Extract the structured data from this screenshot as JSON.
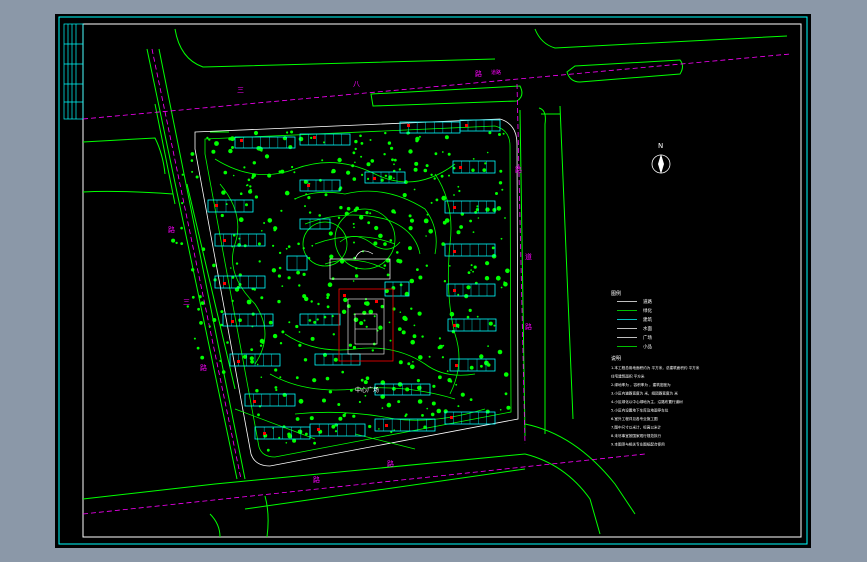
{
  "drawing": {
    "north_label": "N",
    "road_labels": {
      "north_left": "三",
      "north_mid": "八",
      "north_right": "路",
      "north_right2": "道路",
      "east_top": "路",
      "east_mid": "道",
      "east_low": "路",
      "west_top": "路",
      "west_mid": "三",
      "west_low": "路",
      "south_mid": "路",
      "south_left": "路"
    },
    "center_label": "中心广场",
    "legend": {
      "title": "图例",
      "rows": [
        "道路",
        "绿化",
        "建筑",
        "水面",
        "广场",
        "小品"
      ]
    },
    "notes": {
      "title": "说明",
      "lines": [
        "1.本工程总用地面积约为 平方米，总建筑面积约 平方米",
        "  住宅建筑面积 平方米",
        "2.绿地率为 ，容积率为 ，建筑密度为",
        "3.小区内道路宽度为 米，组团路宽度为 米",
        "4.小区绿化以中心绿地为主，沿路布置行道树",
        "5.小区内设置地下车库及地面停车位",
        "6.室外工程详见各专业施工图",
        "7.图中尺寸以米计，标高以米计",
        "8.未尽事宜按国家现行规范执行",
        "9.本图须与相关专业图纸配合使用"
      ]
    },
    "colors": {
      "road": "#00ff00",
      "building": "#00ffff",
      "dashed": "#ff00ff",
      "red": "#ff0000",
      "white": "#ffffff",
      "frame": "#00ffff"
    }
  }
}
